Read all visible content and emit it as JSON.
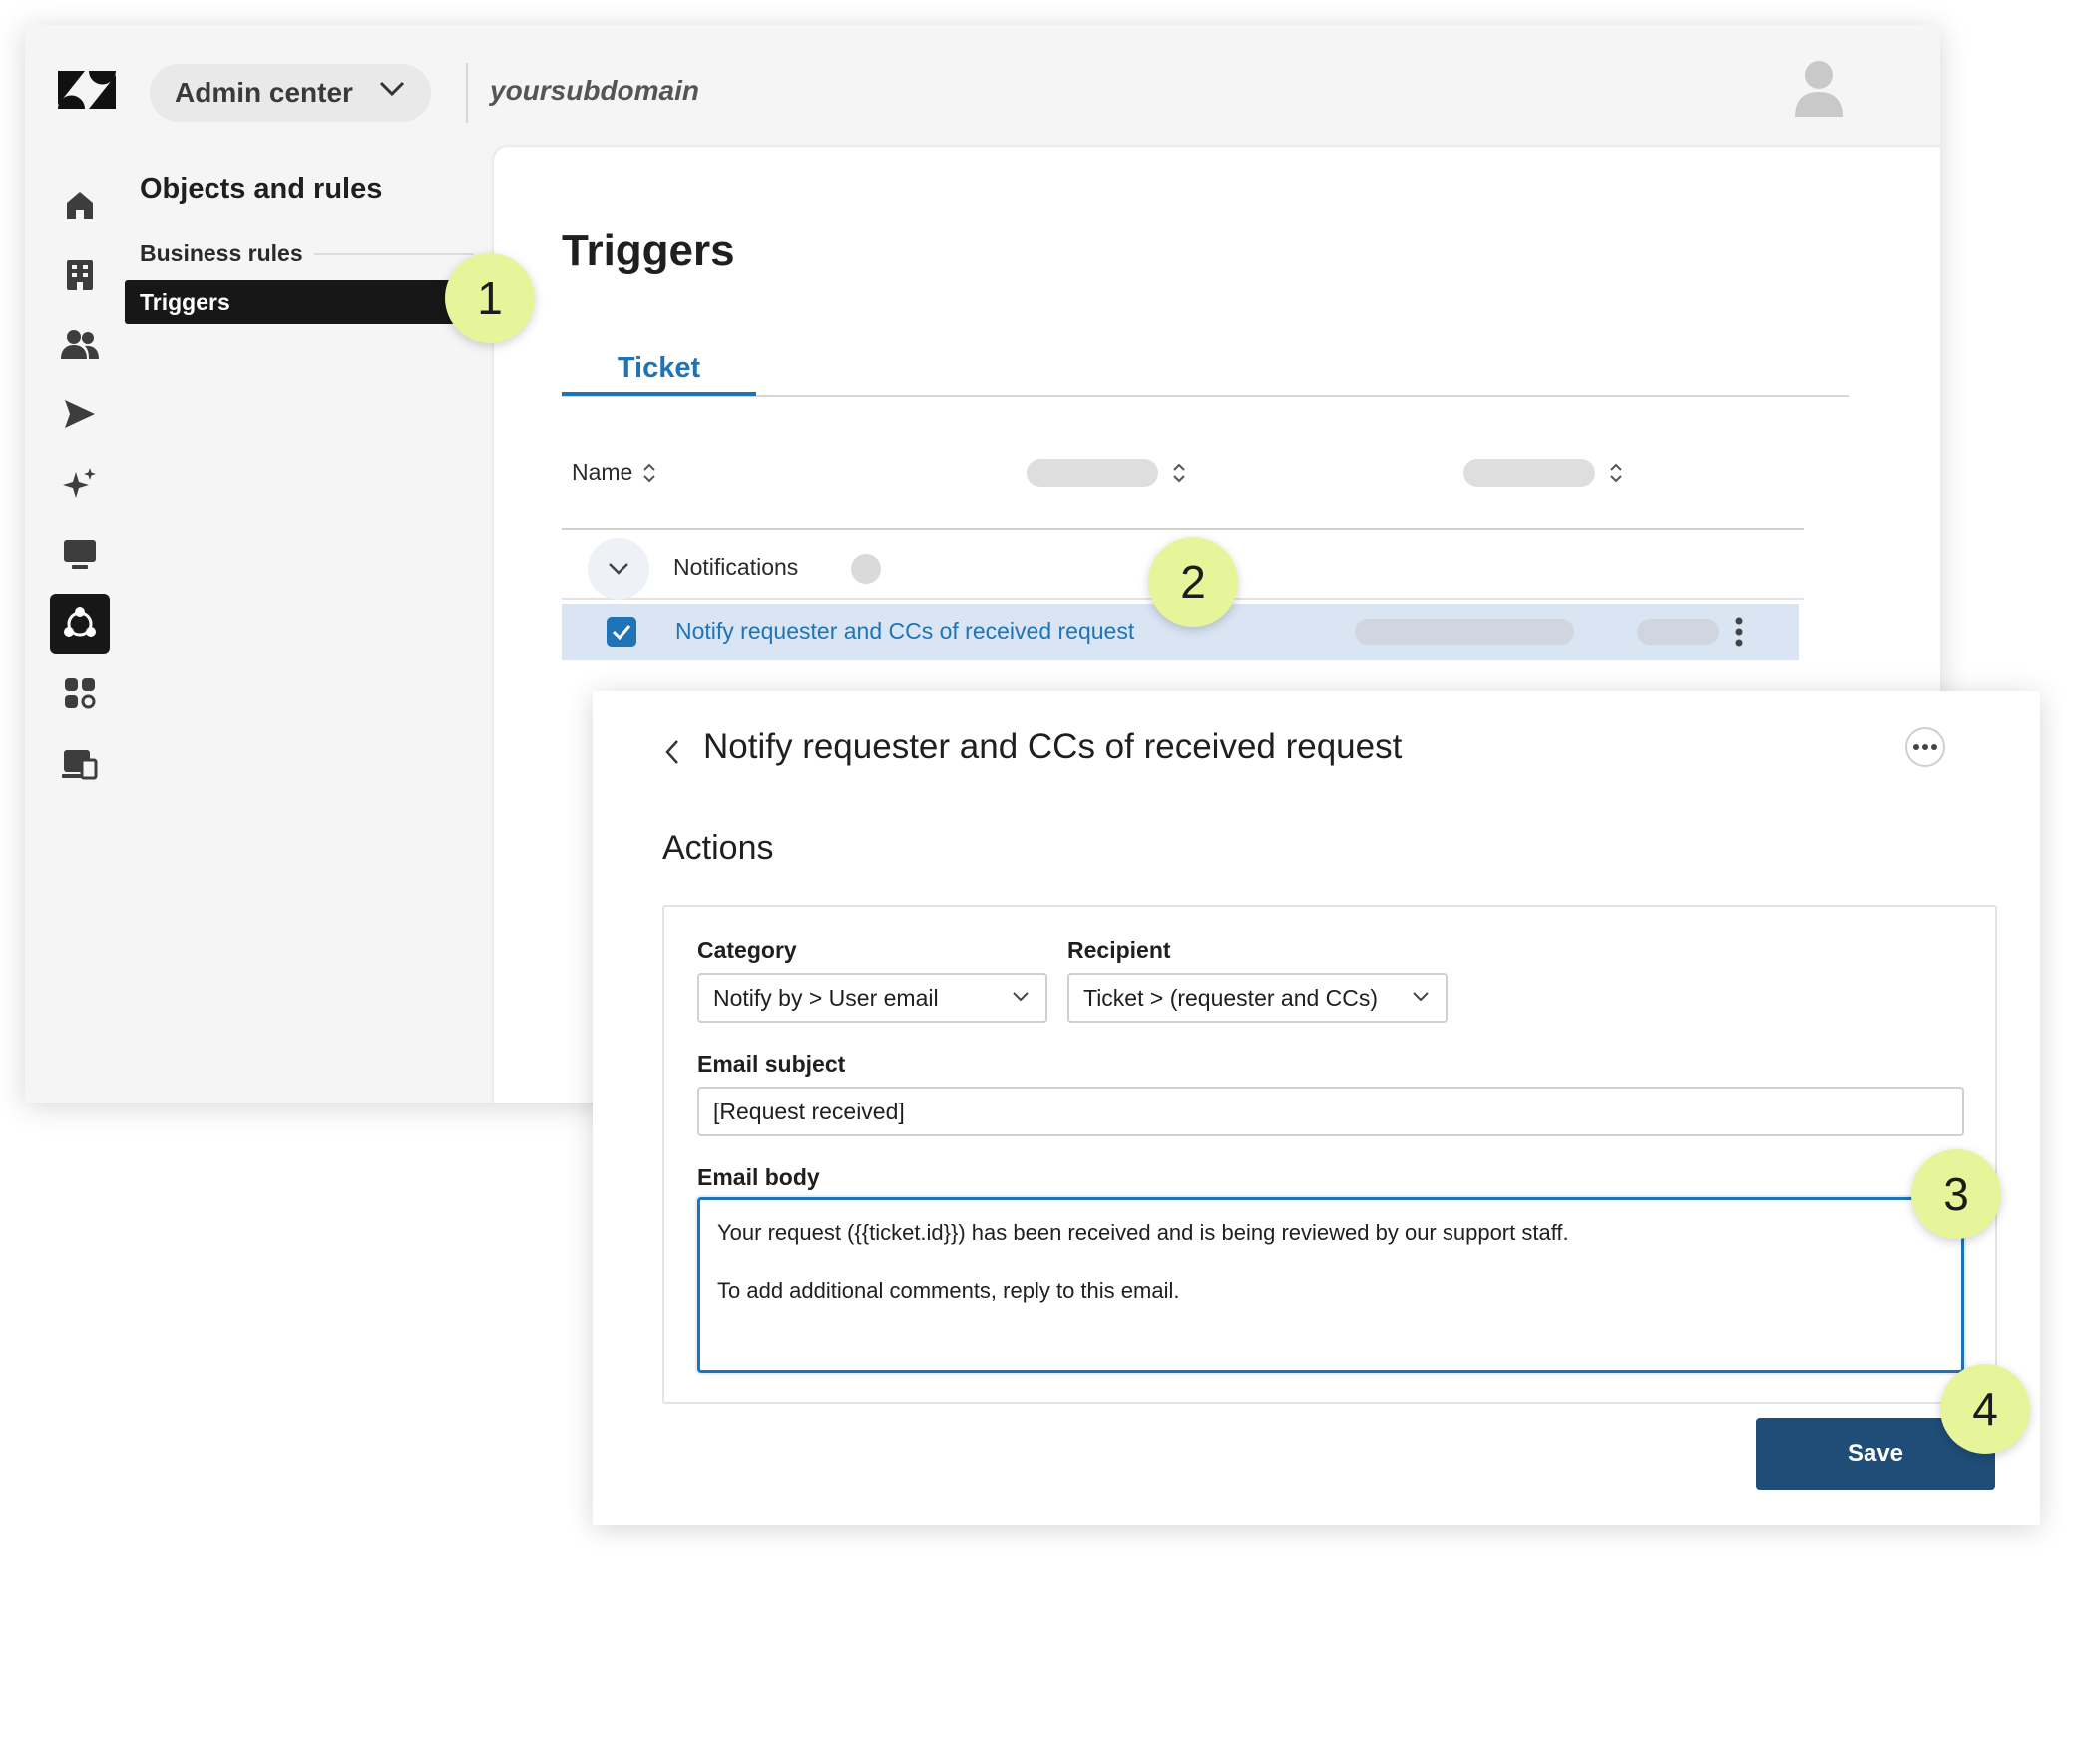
{
  "header": {
    "product_menu_label": "Admin center",
    "subdomain": "yoursubdomain"
  },
  "rail": {
    "items": [
      "home-icon",
      "building-icon",
      "people-icon",
      "channels-icon",
      "ai-sparkle-icon",
      "workspaces-icon",
      "objects-rules-icon",
      "apps-integrations-icon",
      "account-icon"
    ],
    "active": "objects-rules-icon"
  },
  "subnav": {
    "title": "Objects and rules",
    "section": "Business rules",
    "active_item": "Triggers"
  },
  "page": {
    "title": "Triggers",
    "tabs": [
      {
        "label": "Ticket",
        "selected": true
      }
    ],
    "table": {
      "columns": [
        "Name"
      ],
      "group": {
        "label": "Notifications"
      },
      "rows": [
        {
          "name": "Notify requester and CCs of received request",
          "checked": true
        }
      ]
    }
  },
  "detail": {
    "title": "Notify requester and CCs of received request",
    "section_title": "Actions",
    "category": {
      "label": "Category",
      "value": "Notify by > User email"
    },
    "recipient": {
      "label": "Recipient",
      "value": "Ticket > (requester and CCs)"
    },
    "email_subject": {
      "label": "Email subject",
      "value": "[Request received]"
    },
    "email_body": {
      "label": "Email body",
      "lines": [
        "Your request ({{ticket.id}}) has been received and is being reviewed by our support staff.",
        "To add additional comments, reply to this email."
      ]
    },
    "save_label": "Save"
  },
  "steps": [
    "1",
    "2",
    "3",
    "4"
  ],
  "colors": {
    "accent": "#1f73b7",
    "save_button": "#1f4d78",
    "step_badge": "#e6f59a",
    "selected_row": "#d9e5f3",
    "nav_active": "#171717"
  }
}
